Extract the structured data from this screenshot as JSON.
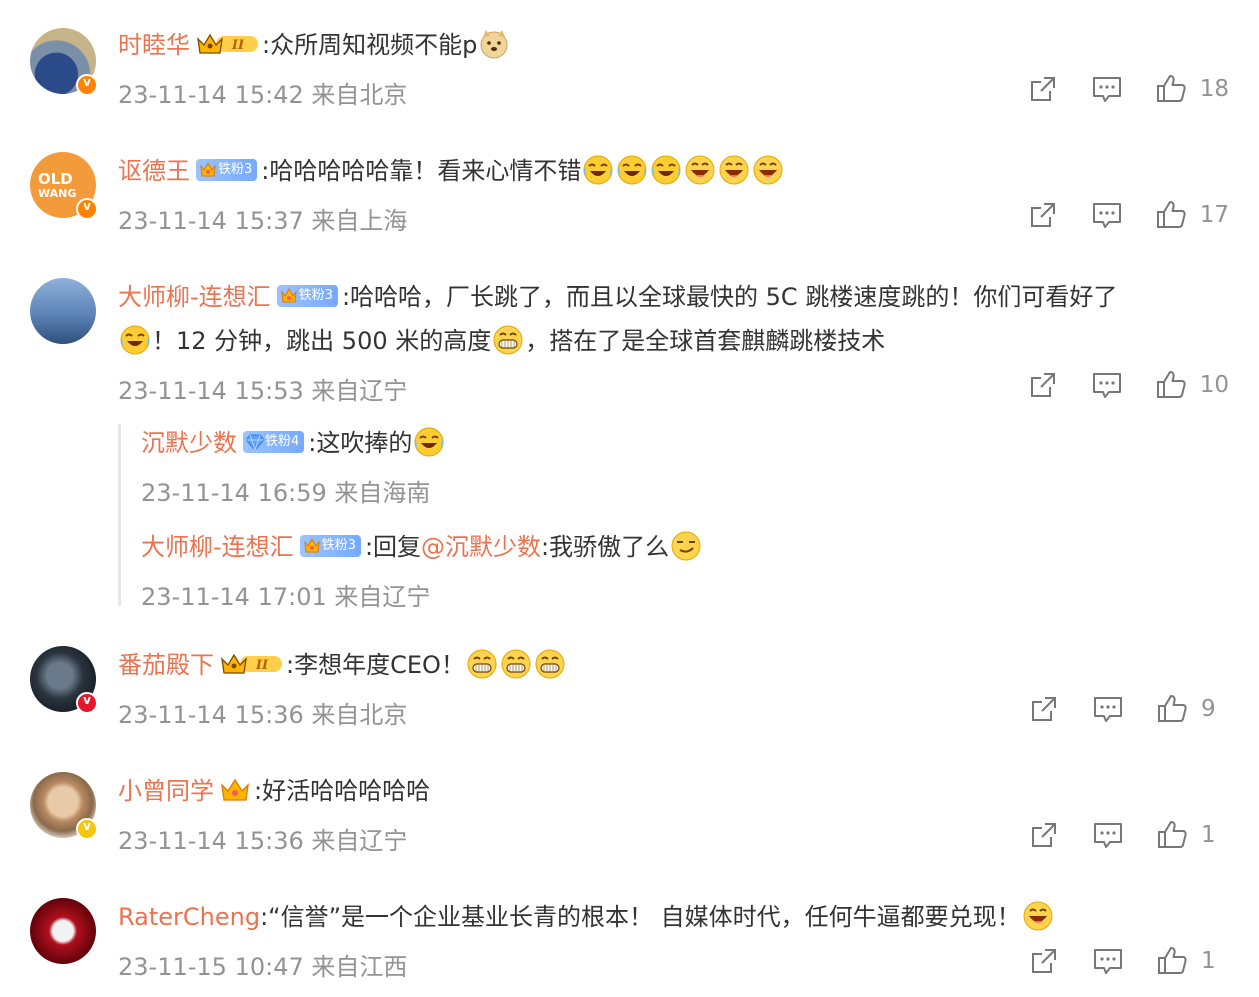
{
  "comments": [
    {
      "user": "时睦华",
      "text": ":众所周知视频不能p",
      "time": "23-11-14 15:42 来自北京",
      "likes": "18"
    },
    {
      "user": "讴德王",
      "fan_label": "铁粉3",
      "text": ":哈哈哈哈哈靠！看来心情不错",
      "time": "23-11-14 15:37 来自上海",
      "likes": "17"
    },
    {
      "user": "大师柳-连想汇",
      "fan_label": "铁粉3",
      "text_line1": ":哈哈哈，厂长跳了，而且以全球最快的 5C 跳楼速度跳的！你们可看好了",
      "text_line2a": "！12 分钟，跳出 500 米的高度",
      "text_line2b": "，搭在了是全球首套麒麟跳楼技术",
      "time": "23-11-14 15:53 来自辽宁",
      "likes": "10",
      "replies": [
        {
          "user": "沉默少数",
          "fan_label": "铁粉4",
          "text": ":这吹捧的",
          "time": "23-11-14 16:59 来自海南"
        },
        {
          "user": "大师柳-连想汇",
          "fan_label": "铁粉3",
          "text_prefix": ":回复",
          "mention": "@沉默少数",
          "text": ":我骄傲了么",
          "time": "23-11-14 17:01 来自辽宁"
        }
      ]
    },
    {
      "user": "番茄殿下",
      "text": ":李想年度CEO！",
      "time": "23-11-14 15:36 来自北京",
      "likes": "9"
    },
    {
      "user": "小曾同学",
      "text": ":好活哈哈哈哈哈",
      "time": "23-11-14 15:36 来自辽宁",
      "likes": "1"
    },
    {
      "user": "RaterCheng",
      "text": ":“信誉”是一个企业基业长青的根本！ 自媒体时代，任何牛逼都要兑现！",
      "time": "23-11-15 10:47 来自江西",
      "likes": "1"
    }
  ],
  "colors": {
    "username": "#eb7350",
    "text": "#333333",
    "meta": "#939393",
    "divider": "#e6e6e6"
  },
  "icons": [
    "share-icon",
    "comment-icon",
    "like-icon",
    "crown-badge-icon",
    "fan-badge-icon",
    "laugh-cry-emoji",
    "grin-emoji",
    "doge-emoji",
    "smirk-emoji"
  ]
}
